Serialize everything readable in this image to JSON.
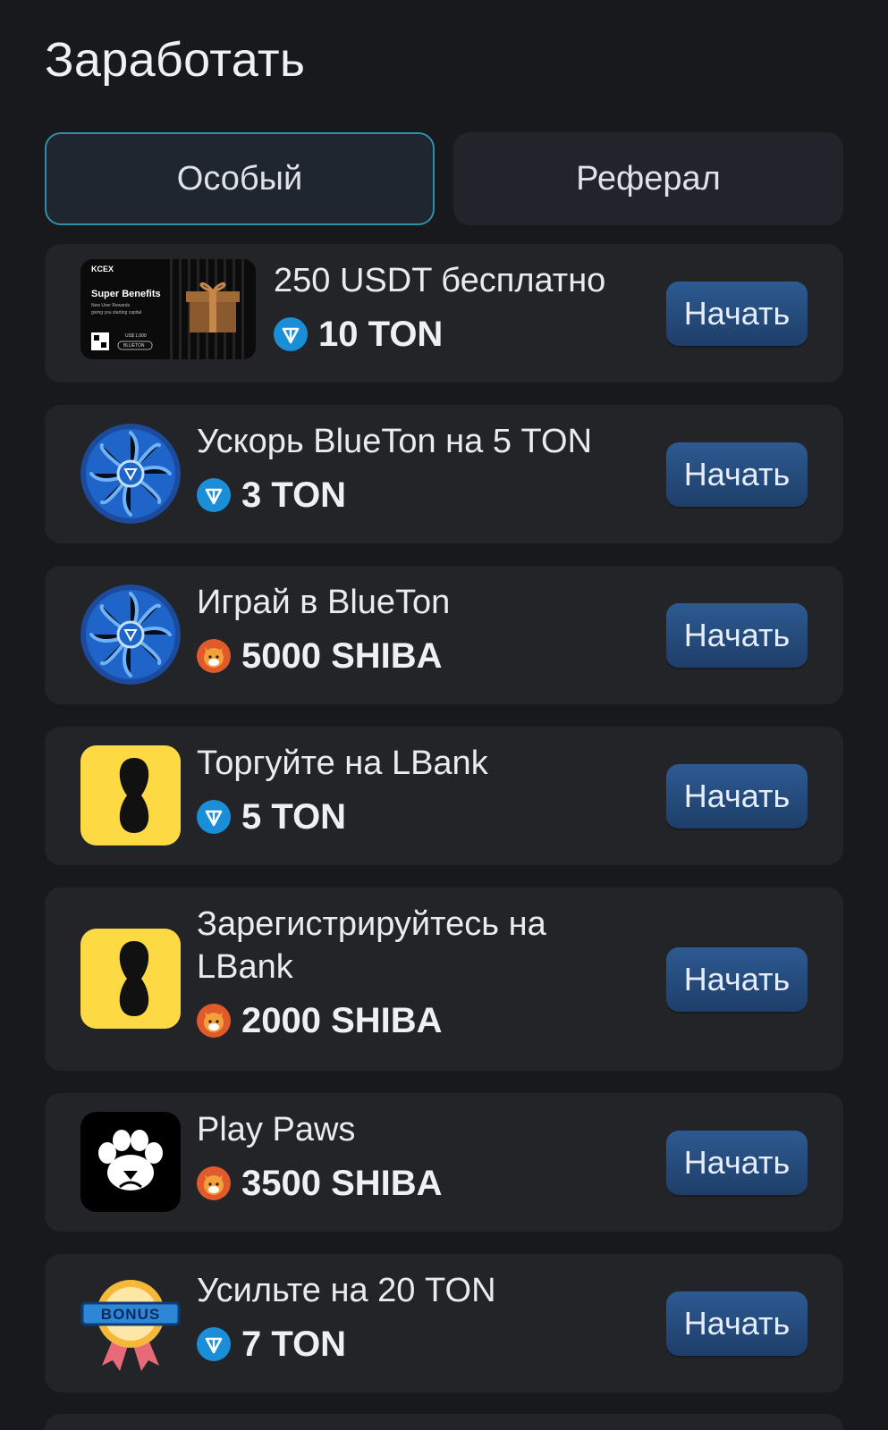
{
  "page": {
    "title": "Заработать"
  },
  "tabs": [
    {
      "label": "Особый",
      "active": true
    },
    {
      "label": "Реферал",
      "active": false
    }
  ],
  "colors": {
    "background": "#17191d",
    "card": "#222428",
    "accent_border": "#2f8fab",
    "button": "#2a5389",
    "ton_coin": "#1a8fd8",
    "shiba_coin": "#e05a2b",
    "lbank_yellow": "#fdd944"
  },
  "tasks": [
    {
      "title": "250 USDT бесплатно",
      "reward_icon": "ton-coin-icon",
      "reward": "10 TON",
      "button": "Начать",
      "icon": "kcex-super-benefits-banner",
      "banner": {
        "brand": "KCEX",
        "headline": "Super Benefits",
        "sub1": "New User Rewards",
        "sub2": "giving you starting capital",
        "badge": "BLUETON",
        "tag": "US$ 1,000"
      }
    },
    {
      "title": "Ускорь BlueTon на 5 TON",
      "reward_icon": "ton-coin-icon",
      "reward": "3 TON",
      "button": "Начать",
      "icon": "blueton-turbine-icon"
    },
    {
      "title": "Играй в BlueTon",
      "reward_icon": "shiba-coin-icon",
      "reward": "5000 SHIBA",
      "button": "Начать",
      "icon": "blueton-turbine-icon"
    },
    {
      "title": "Торгуйте на LBank",
      "reward_icon": "ton-coin-icon",
      "reward": "5 TON",
      "button": "Начать",
      "icon": "lbank-logo-icon"
    },
    {
      "title": "Зарегистрируйтесь на LBank",
      "reward_icon": "shiba-coin-icon",
      "reward": "2000 SHIBA",
      "button": "Начать",
      "icon": "lbank-logo-icon"
    },
    {
      "title": "Play Paws",
      "reward_icon": "shiba-coin-icon",
      "reward": "3500 SHIBA",
      "button": "Начать",
      "icon": "paw-logo-icon"
    },
    {
      "title": "Усильте на 20 TON",
      "reward_icon": "ton-coin-icon",
      "reward": "7 TON",
      "button": "Начать",
      "icon": "bonus-badge-icon",
      "badge_text": "BONUS"
    }
  ]
}
